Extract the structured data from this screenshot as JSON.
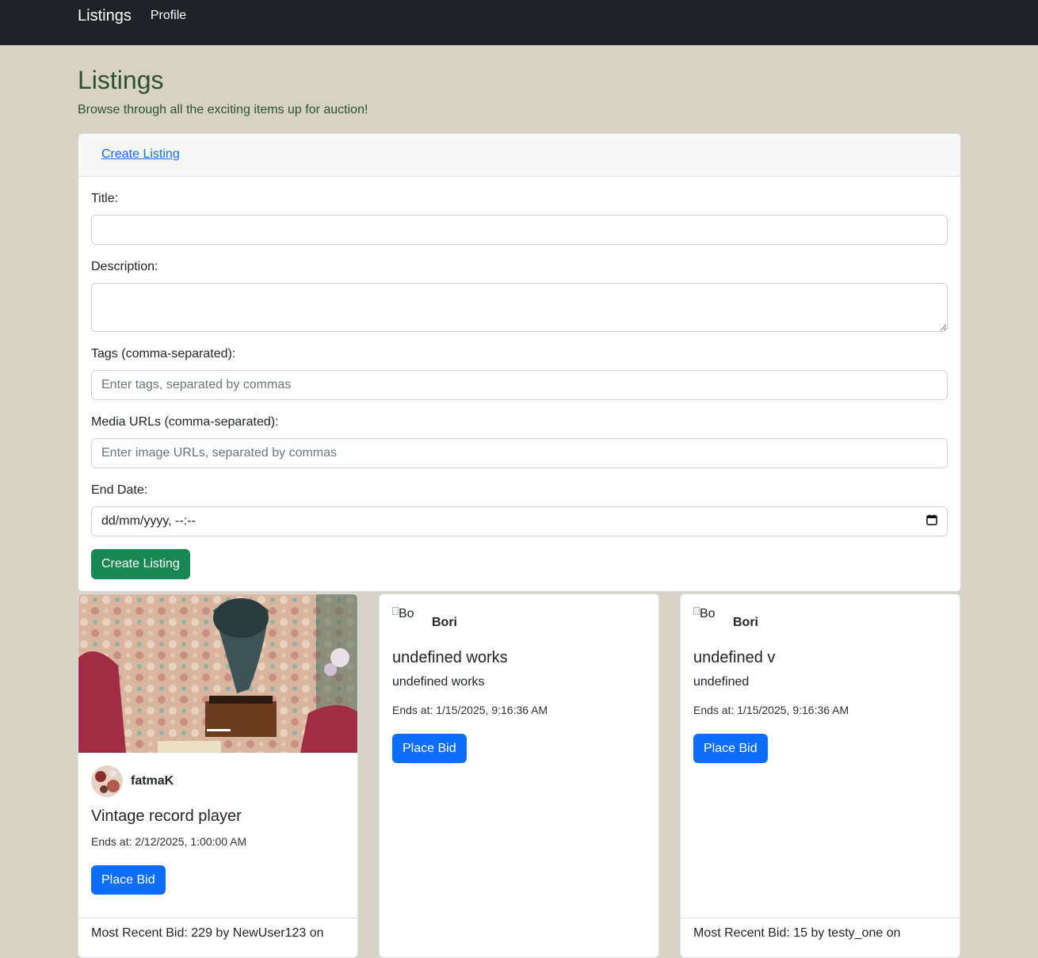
{
  "nav": {
    "brand": "Listings",
    "profile": "Profile"
  },
  "page": {
    "title": "Listings",
    "subtitle": "Browse through all the exciting items up for auction!"
  },
  "form": {
    "header_link": "Create Listing",
    "title_label": "Title:",
    "title_value": "",
    "description_label": "Description:",
    "description_value": "",
    "tags_label": "Tags (comma-separated):",
    "tags_placeholder": "Enter tags, separated by commas",
    "media_label": "Media URLs (comma-separated):",
    "media_placeholder": "Enter image URLs, separated by commas",
    "end_label": "End Date:",
    "end_value": "dd/mm/yyyy, --:--",
    "submit": "Create Listing"
  },
  "listings": [
    {
      "seller": "fatmaK",
      "title": "Vintage record player",
      "ends": "Ends at: 2/12/2025, 1:00:00 AM",
      "bid_button": "Place Bid",
      "recent_bid": "Most Recent Bid: 229 by NewUser123 on"
    },
    {
      "seller": "Bori",
      "avatar_alt": "Bo",
      "title": "undefined works",
      "description": "undefined works",
      "ends": "Ends at: 1/15/2025, 9:16:36 AM",
      "bid_button": "Place Bid"
    },
    {
      "seller": "Bori",
      "avatar_alt": "Bo",
      "title": "undefined v",
      "description": "undefined",
      "ends": "Ends at: 1/15/2025, 9:16:36 AM",
      "bid_button": "Place Bid",
      "recent_bid": "Most Recent Bid: 15 by testy_one on"
    }
  ]
}
